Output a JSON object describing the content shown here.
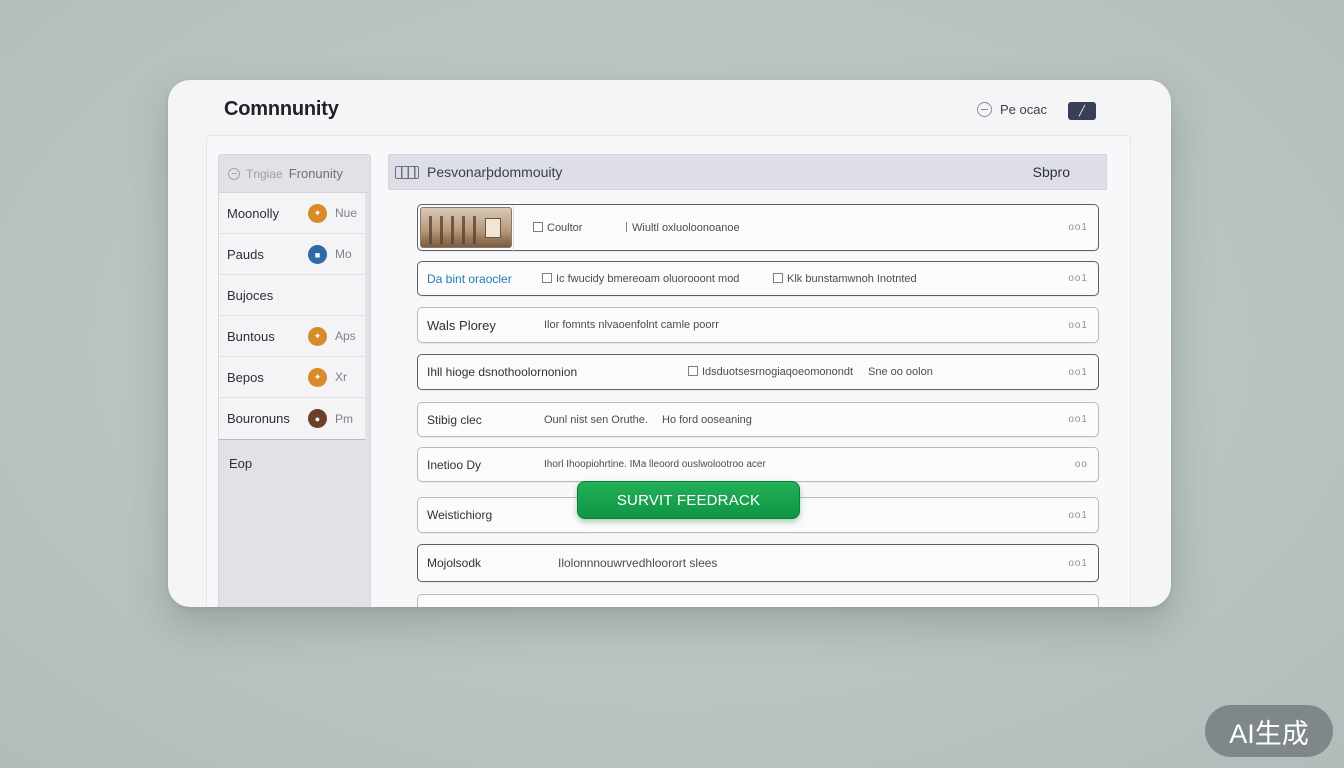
{
  "window": {
    "title": "Comnnunity",
    "header_link": "Pe ocac"
  },
  "sidebar": {
    "header_label": "Tngiae",
    "header_title": "Fronunity",
    "items": [
      {
        "label": "Moonolly",
        "tag": "Nue",
        "badge_color": "#d98a2a"
      },
      {
        "label": "Pauds",
        "tag": "Mo",
        "badge_color": "#2d6aa6"
      },
      {
        "label": "Bujoces",
        "tag": "",
        "badge_color": ""
      },
      {
        "label": "Buntous",
        "tag": "Aps",
        "badge_color": "#d98a2a"
      },
      {
        "label": "Bepos",
        "tag": "Xr",
        "badge_color": "#d98a2a"
      },
      {
        "label": "Bouronuns",
        "tag": "Pm",
        "badge_color": "#6b3f2a"
      }
    ],
    "extra": "Eop"
  },
  "panel": {
    "title": "Pesvonarþdommouity",
    "action": "Sbpro"
  },
  "rows": [
    {
      "lead": "",
      "desc1": "Coultor",
      "desc2": "Wiultl oxluoloonoanoe",
      "more": "oo1"
    },
    {
      "lead": "Da bint oraocler",
      "desc1": "Ic fwucidy bmereoam oluorooont mod",
      "desc2": "Klk bunstamwnoh Inotnted",
      "more": "oo1"
    },
    {
      "lead": "Wals Plorey",
      "desc1": "Ilor fomnts nlvaoenfolnt camle poorr",
      "desc2": "",
      "more": "oo1"
    },
    {
      "lead": "Ihll hioge dsnothoolornonion",
      "desc1": "Idsduotsesrnogiaqoeomonondt",
      "desc2": "Sne oo oolon",
      "more": "oo1"
    },
    {
      "lead": "Stibig clec",
      "desc1": "Ounl nist sen Oruthe.",
      "desc2": "Ho ford ooseaning",
      "more": "oo1"
    },
    {
      "lead": "Inetioo Dy",
      "desc1": "Ihorl Ihoopiohrtine. IMa lleoord ouslwolootroo acer",
      "desc2": "",
      "more": "oo"
    },
    {
      "lead": "Weistichiorg",
      "desc1": "",
      "desc2": "",
      "more": "oo1"
    },
    {
      "lead": "Mojolsodk",
      "desc1": "Ilolonnnouwrvedhloorort slees",
      "desc2": "",
      "more": "oo1"
    }
  ],
  "submit_label": "SURVIT FEEDRACK",
  "watermark": "AI生成",
  "colors": {
    "accent_green": "#18a24d",
    "header_button": "#3a3f58",
    "link_blue": "#1b7fb0"
  }
}
